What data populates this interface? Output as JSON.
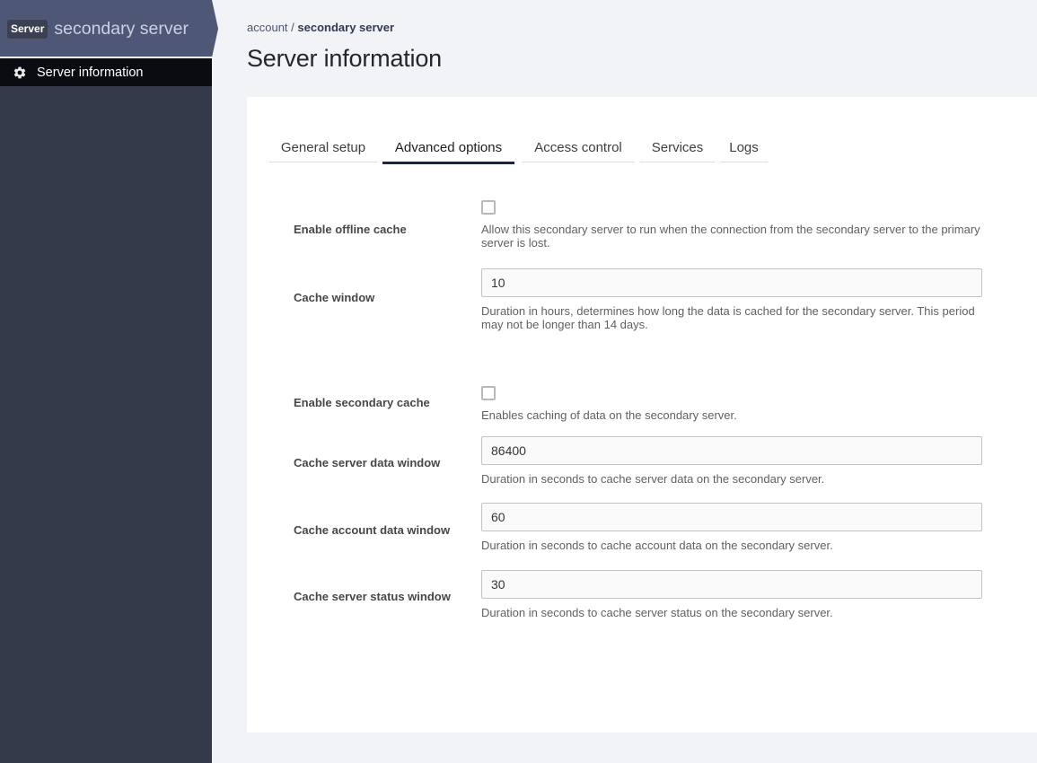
{
  "sidebar": {
    "badge": "Server",
    "server_name": "secondary server",
    "nav_items": [
      {
        "label": "Server information",
        "icon": "gear-icon",
        "active": true
      }
    ]
  },
  "breadcrumb": {
    "parent": "account",
    "separator": " / ",
    "current": "secondary server"
  },
  "page": {
    "title": "Server information"
  },
  "tabs": [
    {
      "label": "General setup",
      "active": false
    },
    {
      "label": "Advanced options",
      "active": true
    },
    {
      "label": "Access control",
      "active": false
    },
    {
      "label": "Services",
      "active": false
    },
    {
      "label": "Logs",
      "active": false
    }
  ],
  "form": {
    "rows": [
      {
        "type": "checkbox",
        "label": "Enable offline cache",
        "checked": false,
        "help": "Allow this secondary server to run when the connection from the secondary server to the primary server is lost.",
        "group_gap": false
      },
      {
        "type": "text",
        "label": "Cache window",
        "value": "10",
        "help": "Duration in hours, determines how long the data is cached for the secondary server. This period may not be longer than 14 days.",
        "group_gap": false
      },
      {
        "type": "checkbox",
        "label": "Enable secondary cache",
        "checked": false,
        "help": "Enables caching of data on the secondary server.",
        "group_gap": true
      },
      {
        "type": "text",
        "label": "Cache server data window",
        "value": "86400",
        "help": "Duration in seconds to cache server data on the secondary server.",
        "group_gap": false
      },
      {
        "type": "text",
        "label": "Cache account data window",
        "value": "60",
        "help": "Duration in seconds to cache account data on the secondary server.",
        "group_gap": false
      },
      {
        "type": "text",
        "label": "Cache server status window",
        "value": "30",
        "help": "Duration in seconds to cache server status on the secondary server.",
        "group_gap": false
      }
    ]
  },
  "colors": {
    "sidebar_body": "#343a49",
    "sidebar_header": "#4e5876",
    "nav_active_bg": "#0b0c11",
    "content_bg": "#f2f3f6",
    "card_bg": "#ffffff",
    "tab_active_underline": "#1e2537",
    "accent_text": "#303a55"
  }
}
